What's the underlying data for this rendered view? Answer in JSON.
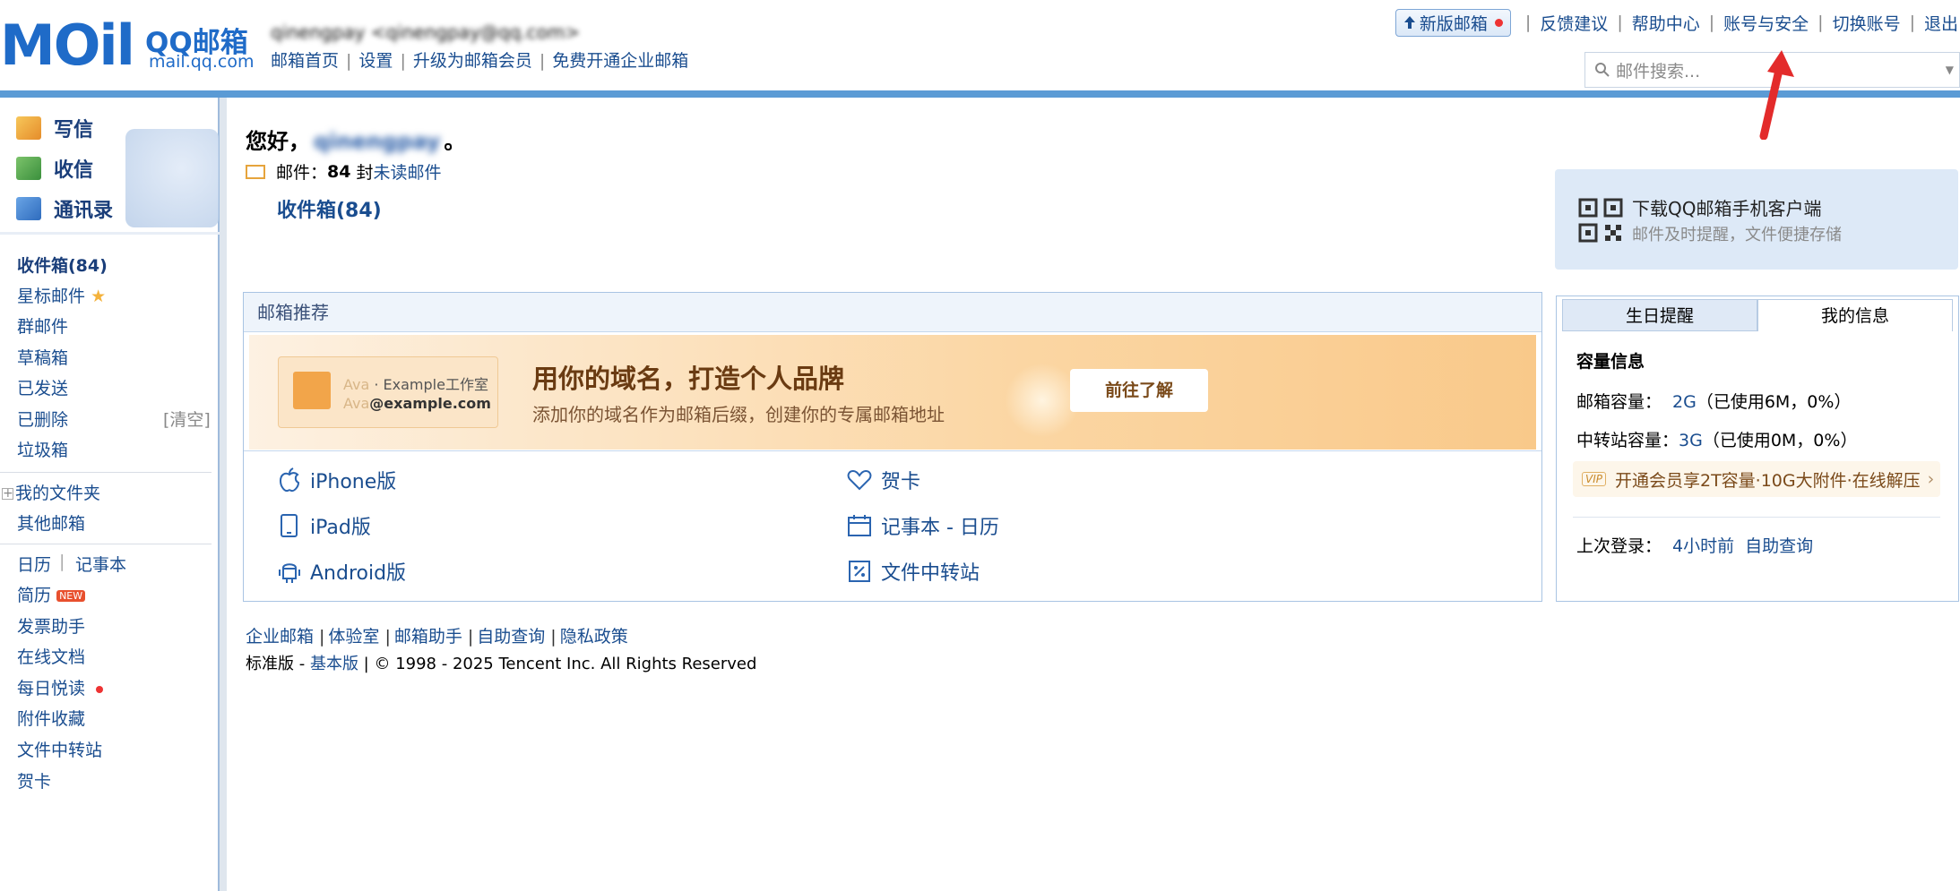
{
  "header": {
    "logo_text": "MOil",
    "brand_name": "QQ邮箱",
    "brand_domain": "mail.qq.com",
    "account_prefix": "qinengpay",
    "account_email": "<qinengpay@qq.com>",
    "top_links": [
      "邮箱首页",
      "设置",
      "升级为邮箱会员",
      "免费开通企业邮箱"
    ],
    "new_version": "新版邮箱",
    "nav": [
      "反馈建议",
      "帮助中心",
      "账号与安全",
      "切换账号",
      "退出"
    ],
    "search_placeholder": "邮件搜索..."
  },
  "quick_actions": {
    "write": "写信",
    "receive": "收信",
    "contacts": "通讯录"
  },
  "folders": {
    "inbox": "收件箱(84)",
    "starred": "星标邮件",
    "group": "群邮件",
    "drafts": "草稿箱",
    "sent": "已发送",
    "deleted": "已删除",
    "clear": "[清空]",
    "trash": "垃圾箱",
    "my_folders": "我的文件夹",
    "other_mailbox": "其他邮箱",
    "calendar": "日历",
    "notebook": "记事本",
    "resume": "简历",
    "new_badge": "NEW",
    "invoice": "发票助手",
    "docs": "在线文档",
    "daily": "每日悦读",
    "attachments": "附件收藏",
    "file_transfer": "文件中转站",
    "cards": "贺卡"
  },
  "main": {
    "greeting_prefix": "您好，",
    "greeting_name": "qinengpay",
    "greeting_suffix": "。",
    "mail_label": "邮件：",
    "mail_count": "84",
    "mail_unit": "封",
    "unread_link": "未读邮件",
    "inbox_link": "收件箱(84)"
  },
  "app_download": {
    "title": "下载QQ邮箱手机客户端",
    "subtitle": "邮件及时提醒，文件便捷存储"
  },
  "recommend": {
    "heading": "邮箱推荐",
    "banner": {
      "card_line1_name": "Ava",
      "card_line1_rest": " · Example工作室",
      "card_line2_name": "Ava",
      "card_line2_rest": "@example.com",
      "title": "用你的域名，打造个人品牌",
      "subtitle": "添加你的域名作为邮箱后缀，创建你的专属邮箱地址",
      "button": "前往了解"
    },
    "links_left": [
      "iPhone版",
      "iPad版",
      "Android版"
    ],
    "links_right": [
      "贺卡",
      "记事本 - 日历",
      "文件中转站"
    ]
  },
  "info_panel": {
    "tabs": [
      "生日提醒",
      "我的信息"
    ],
    "capacity_title": "容量信息",
    "mailbox_label": "邮箱容量：",
    "mailbox_value": "2G",
    "mailbox_usage": "（已使用6M，0%）",
    "transfer_label": "中转站容量：",
    "transfer_value": "3G",
    "transfer_usage": "（已使用0M，0%）",
    "vip_badge": "VIP",
    "vip_text": "开通会员享2T容量·10G大附件·在线解压",
    "last_login_label": "上次登录：",
    "last_login_value": "4小时前",
    "self_query": "自助查询"
  },
  "footer": {
    "links": [
      "企业邮箱",
      "体验室",
      "邮箱助手",
      "自助查询",
      "隐私政策"
    ],
    "edition": "标准版",
    "basic": "基本版",
    "copyright": "© 1998 - 2025 Tencent Inc. All Rights Reserved"
  },
  "colors": {
    "link": "#1a4d8f",
    "header_bar": "#5b9bd5",
    "banner": "#fbd6a3",
    "accent_red": "#e32b2b"
  }
}
